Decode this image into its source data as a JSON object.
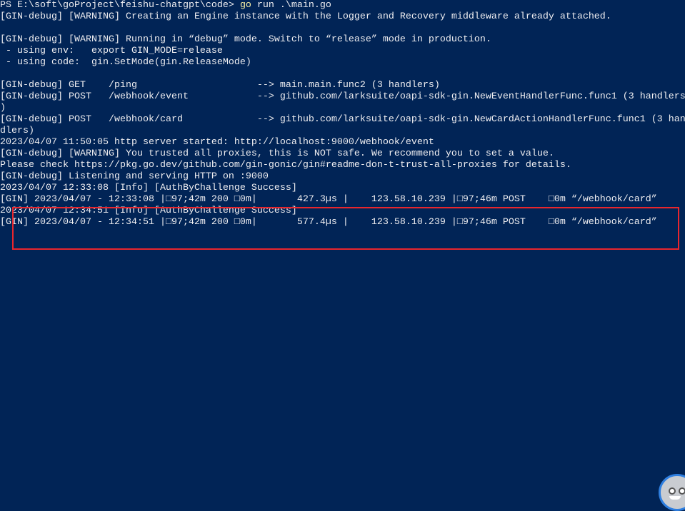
{
  "terminal": {
    "prompt": "PS E:\\soft\\goProject\\feishu-chatgpt\\code> ",
    "command": "go",
    "command_args": " run .\\main.go",
    "lines": [
      "[GIN-debug] [WARNING] Creating an Engine instance with the Logger and Recovery middleware already attached.",
      "",
      "[GIN-debug] [WARNING] Running in “debug” mode. Switch to “release” mode in production.",
      " - using env:   export GIN_MODE=release",
      " - using code:  gin.SetMode(gin.ReleaseMode)",
      "",
      "[GIN-debug] GET    /ping                     --> main.main.func2 (3 handlers)",
      "[GIN-debug] POST   /webhook/event            --> github.com/larksuite/oapi-sdk-gin.NewEventHandlerFunc.func1 (3 handlers",
      ")",
      "[GIN-debug] POST   /webhook/card             --> github.com/larksuite/oapi-sdk-gin.NewCardActionHandlerFunc.func1 (3 han",
      "dlers)",
      "2023/04/07 11:50:05 http server started: http://localhost:9000/webhook/event",
      "[GIN-debug] [WARNING] You trusted all proxies, this is NOT safe. We recommend you to set a value.",
      "Please check https://pkg.go.dev/github.com/gin-gonic/gin#readme-don-t-trust-all-proxies for details.",
      "[GIN-debug] Listening and serving HTTP on :9000",
      "2023/04/07 12:33:08 [Info] [AuthByChallenge Success]",
      "[GIN] 2023/04/07 - 12:33:08 |□97;42m 200 □0m|       427.3µs |    123.58.10.239 |□97;46m POST    □0m “/webhook/card”",
      "2023/04/07 12:34:51 [Info] [AuthByChallenge Success]",
      "[GIN] 2023/04/07 - 12:34:51 |□97;42m 200 □0m|       577.4µs |    123.58.10.239 |□97;46m POST    □0m “/webhook/card”"
    ]
  },
  "colors": {
    "background": "#012456",
    "text": "#eeedf0",
    "command": "#f9f1a5",
    "highlight_box": "#e8262d"
  },
  "overlay": {
    "icon": "assistant-avatar-icon"
  }
}
